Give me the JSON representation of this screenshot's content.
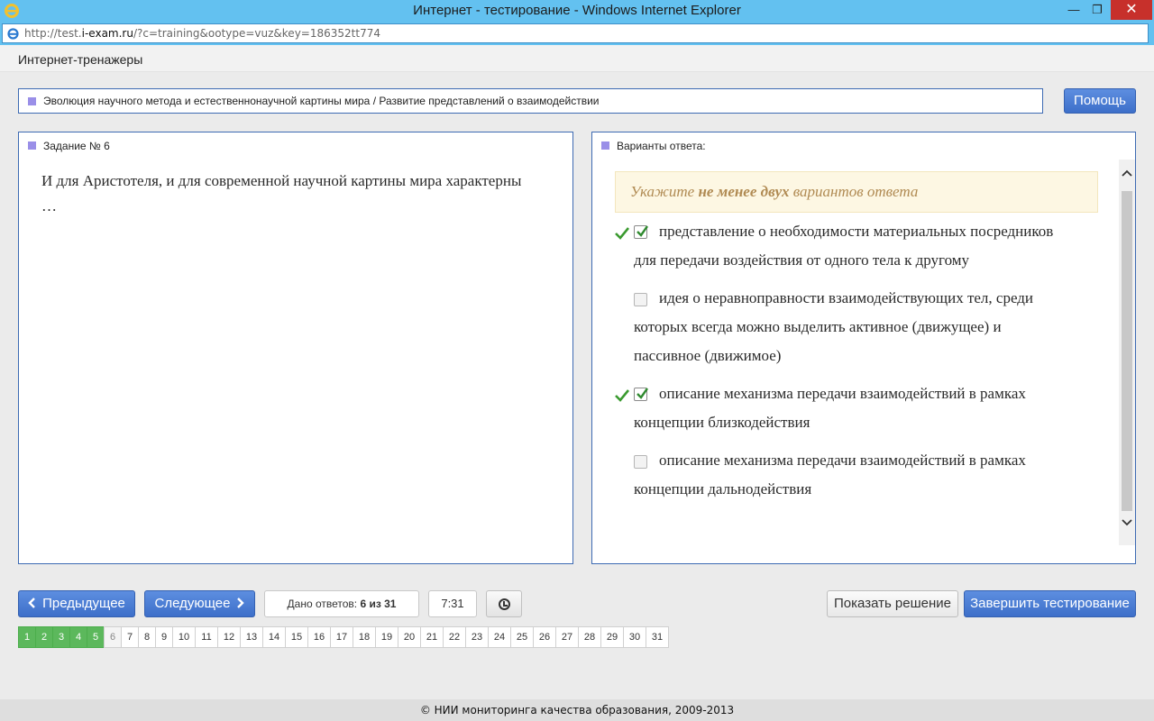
{
  "window": {
    "title": "Интернет - тестирование - Windows Internet Explorer",
    "minimize": "—",
    "maximize": "❐",
    "close": "✕"
  },
  "address": {
    "url_prefix": "http://test.",
    "url_domain": "i-exam.ru",
    "url_rest": "/?c=training&ootype=vuz&key=186352tt774"
  },
  "app": {
    "header": "Интернет-тренажеры"
  },
  "topic": "Эволюция научного метода и естественнонаучной картины мира / Развитие представлений о взаимодействии",
  "help_label": "Помощь",
  "task": {
    "title": "Задание № 6",
    "question": "И для Аристотеля, и для современной научной картины мира характерны …"
  },
  "answers": {
    "title": "Варианты ответа:",
    "hint_before": "Укажите ",
    "hint_bold": "не менее двух",
    "hint_after": " вариантов ответа",
    "options": [
      {
        "text": "представление о необходимости материальных посредников для передачи воздействия от одного тела к другому",
        "checked": true,
        "correct": true
      },
      {
        "text": "идея о неравноправности взаимодействующих тел, среди которых всегда можно выделить активное (движущее) и пассивное (движимое)",
        "checked": false,
        "correct": false
      },
      {
        "text": "описание механизма передачи взаимодействий  в рамках концепции близкодействия",
        "checked": true,
        "correct": true
      },
      {
        "text": "описание механизма передачи взаимодействий в рамках концепции дальнодействия",
        "checked": false,
        "correct": false
      }
    ]
  },
  "nav": {
    "prev": "Предыдущее",
    "next": "Следующее",
    "answered_label": "Дано ответов: ",
    "answered_value": "6 из 31",
    "timer": "7:31",
    "show_solution": "Показать решение",
    "finish": "Завершить тестирование"
  },
  "pages": {
    "numbers": [
      "1",
      "2",
      "3",
      "4",
      "5",
      "6",
      "7",
      "8",
      "9",
      "10",
      "11",
      "12",
      "13",
      "14",
      "15",
      "16",
      "17",
      "18",
      "19",
      "20",
      "21",
      "22",
      "23",
      "24",
      "25",
      "26",
      "27",
      "28",
      "29",
      "30",
      "31"
    ],
    "done": [
      1,
      2,
      3,
      4,
      5
    ],
    "current": 6
  },
  "footer": "© НИИ мониторинга качества образования, 2009-2013",
  "colors": {
    "accent": "#3d6fc9",
    "done": "#5cb85c",
    "hint_text": "#b08a52",
    "marker": "#9a8fe8"
  }
}
